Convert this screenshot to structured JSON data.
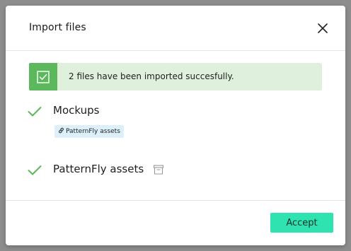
{
  "modal": {
    "title": "Import files",
    "banner": {
      "message": "2 files have been imported succesfully."
    },
    "files": [
      {
        "name": "Mockups",
        "status_icon": "check-icon",
        "tag": {
          "icon": "link-icon",
          "label": "PatternFly assets"
        }
      },
      {
        "name": "PatternFly assets",
        "status_icon": "check-icon",
        "extra_icon": "archive-icon"
      }
    ],
    "footer": {
      "accept_label": "Accept"
    }
  },
  "colors": {
    "success_green": "#5cb85c",
    "banner_bg": "#dff1dc",
    "tag_bg": "#dcf0fb",
    "accept_bg": "#2fe3b0"
  }
}
